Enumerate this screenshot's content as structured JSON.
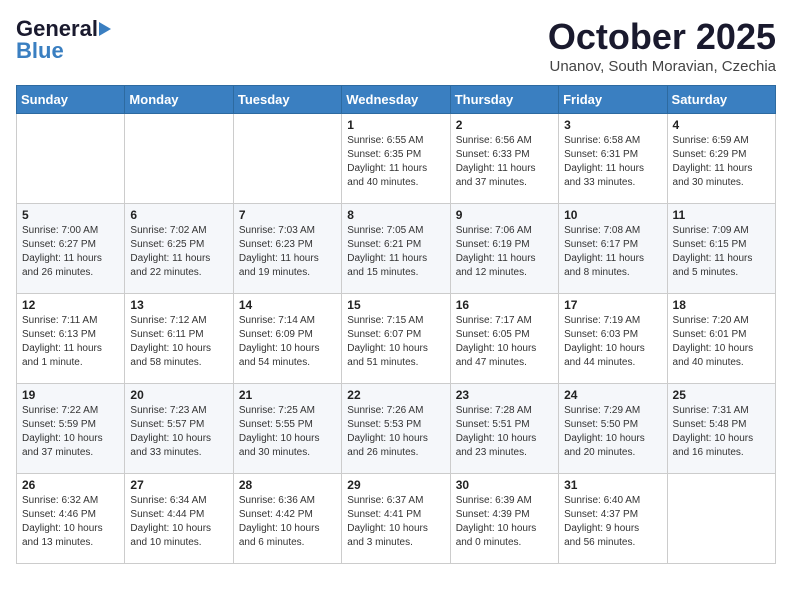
{
  "header": {
    "logo_general": "General",
    "logo_blue": "Blue",
    "month": "October 2025",
    "location": "Unanov, South Moravian, Czechia"
  },
  "days_of_week": [
    "Sunday",
    "Monday",
    "Tuesday",
    "Wednesday",
    "Thursday",
    "Friday",
    "Saturday"
  ],
  "weeks": [
    [
      {
        "day": "",
        "info": ""
      },
      {
        "day": "",
        "info": ""
      },
      {
        "day": "",
        "info": ""
      },
      {
        "day": "1",
        "info": "Sunrise: 6:55 AM\nSunset: 6:35 PM\nDaylight: 11 hours\nand 40 minutes."
      },
      {
        "day": "2",
        "info": "Sunrise: 6:56 AM\nSunset: 6:33 PM\nDaylight: 11 hours\nand 37 minutes."
      },
      {
        "day": "3",
        "info": "Sunrise: 6:58 AM\nSunset: 6:31 PM\nDaylight: 11 hours\nand 33 minutes."
      },
      {
        "day": "4",
        "info": "Sunrise: 6:59 AM\nSunset: 6:29 PM\nDaylight: 11 hours\nand 30 minutes."
      }
    ],
    [
      {
        "day": "5",
        "info": "Sunrise: 7:00 AM\nSunset: 6:27 PM\nDaylight: 11 hours\nand 26 minutes."
      },
      {
        "day": "6",
        "info": "Sunrise: 7:02 AM\nSunset: 6:25 PM\nDaylight: 11 hours\nand 22 minutes."
      },
      {
        "day": "7",
        "info": "Sunrise: 7:03 AM\nSunset: 6:23 PM\nDaylight: 11 hours\nand 19 minutes."
      },
      {
        "day": "8",
        "info": "Sunrise: 7:05 AM\nSunset: 6:21 PM\nDaylight: 11 hours\nand 15 minutes."
      },
      {
        "day": "9",
        "info": "Sunrise: 7:06 AM\nSunset: 6:19 PM\nDaylight: 11 hours\nand 12 minutes."
      },
      {
        "day": "10",
        "info": "Sunrise: 7:08 AM\nSunset: 6:17 PM\nDaylight: 11 hours\nand 8 minutes."
      },
      {
        "day": "11",
        "info": "Sunrise: 7:09 AM\nSunset: 6:15 PM\nDaylight: 11 hours\nand 5 minutes."
      }
    ],
    [
      {
        "day": "12",
        "info": "Sunrise: 7:11 AM\nSunset: 6:13 PM\nDaylight: 11 hours\nand 1 minute."
      },
      {
        "day": "13",
        "info": "Sunrise: 7:12 AM\nSunset: 6:11 PM\nDaylight: 10 hours\nand 58 minutes."
      },
      {
        "day": "14",
        "info": "Sunrise: 7:14 AM\nSunset: 6:09 PM\nDaylight: 10 hours\nand 54 minutes."
      },
      {
        "day": "15",
        "info": "Sunrise: 7:15 AM\nSunset: 6:07 PM\nDaylight: 10 hours\nand 51 minutes."
      },
      {
        "day": "16",
        "info": "Sunrise: 7:17 AM\nSunset: 6:05 PM\nDaylight: 10 hours\nand 47 minutes."
      },
      {
        "day": "17",
        "info": "Sunrise: 7:19 AM\nSunset: 6:03 PM\nDaylight: 10 hours\nand 44 minutes."
      },
      {
        "day": "18",
        "info": "Sunrise: 7:20 AM\nSunset: 6:01 PM\nDaylight: 10 hours\nand 40 minutes."
      }
    ],
    [
      {
        "day": "19",
        "info": "Sunrise: 7:22 AM\nSunset: 5:59 PM\nDaylight: 10 hours\nand 37 minutes."
      },
      {
        "day": "20",
        "info": "Sunrise: 7:23 AM\nSunset: 5:57 PM\nDaylight: 10 hours\nand 33 minutes."
      },
      {
        "day": "21",
        "info": "Sunrise: 7:25 AM\nSunset: 5:55 PM\nDaylight: 10 hours\nand 30 minutes."
      },
      {
        "day": "22",
        "info": "Sunrise: 7:26 AM\nSunset: 5:53 PM\nDaylight: 10 hours\nand 26 minutes."
      },
      {
        "day": "23",
        "info": "Sunrise: 7:28 AM\nSunset: 5:51 PM\nDaylight: 10 hours\nand 23 minutes."
      },
      {
        "day": "24",
        "info": "Sunrise: 7:29 AM\nSunset: 5:50 PM\nDaylight: 10 hours\nand 20 minutes."
      },
      {
        "day": "25",
        "info": "Sunrise: 7:31 AM\nSunset: 5:48 PM\nDaylight: 10 hours\nand 16 minutes."
      }
    ],
    [
      {
        "day": "26",
        "info": "Sunrise: 6:32 AM\nSunset: 4:46 PM\nDaylight: 10 hours\nand 13 minutes."
      },
      {
        "day": "27",
        "info": "Sunrise: 6:34 AM\nSunset: 4:44 PM\nDaylight: 10 hours\nand 10 minutes."
      },
      {
        "day": "28",
        "info": "Sunrise: 6:36 AM\nSunset: 4:42 PM\nDaylight: 10 hours\nand 6 minutes."
      },
      {
        "day": "29",
        "info": "Sunrise: 6:37 AM\nSunset: 4:41 PM\nDaylight: 10 hours\nand 3 minutes."
      },
      {
        "day": "30",
        "info": "Sunrise: 6:39 AM\nSunset: 4:39 PM\nDaylight: 10 hours\nand 0 minutes."
      },
      {
        "day": "31",
        "info": "Sunrise: 6:40 AM\nSunset: 4:37 PM\nDaylight: 9 hours\nand 56 minutes."
      },
      {
        "day": "",
        "info": ""
      }
    ]
  ]
}
